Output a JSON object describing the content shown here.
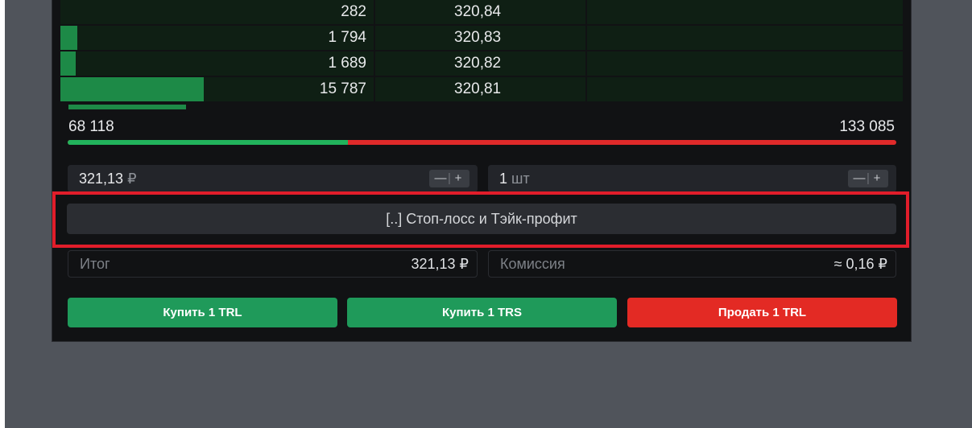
{
  "orderbook": {
    "rows": [
      {
        "qty": "282",
        "price": "320,84",
        "volume_share": 0.0
      },
      {
        "qty": "1 794",
        "price": "320,83",
        "volume_share": 0.02
      },
      {
        "qty": "1 689",
        "price": "320,82",
        "volume_share": 0.018
      },
      {
        "qty": "15 787",
        "price": "320,81",
        "volume_share": 0.17
      }
    ]
  },
  "totals": {
    "buy": "68 118",
    "sell": "133 085",
    "buy_share": 0.338
  },
  "price_field": {
    "value": "321,13",
    "currency": "₽",
    "minus": "—",
    "plus": "+"
  },
  "qty_field": {
    "value": "1",
    "unit": "шт",
    "minus": "—",
    "plus": "+"
  },
  "sltp_button": {
    "label": "[..] Стоп-лосс и Тэйк-профит"
  },
  "summary": {
    "total_label": "Итог",
    "total_value": "321,13 ₽",
    "commission_label": "Комиссия",
    "commission_value": "≈ 0,16 ₽"
  },
  "actions": {
    "buy_trl": "Купить 1 TRL",
    "buy_trs": "Купить 1 TRS",
    "sell_trl": "Продать 1 TRL"
  },
  "colors": {
    "buy": "#1f9a5a",
    "sell": "#e32a24",
    "highlight": "#e11d2a",
    "volume_bar": "#1d8a47"
  }
}
